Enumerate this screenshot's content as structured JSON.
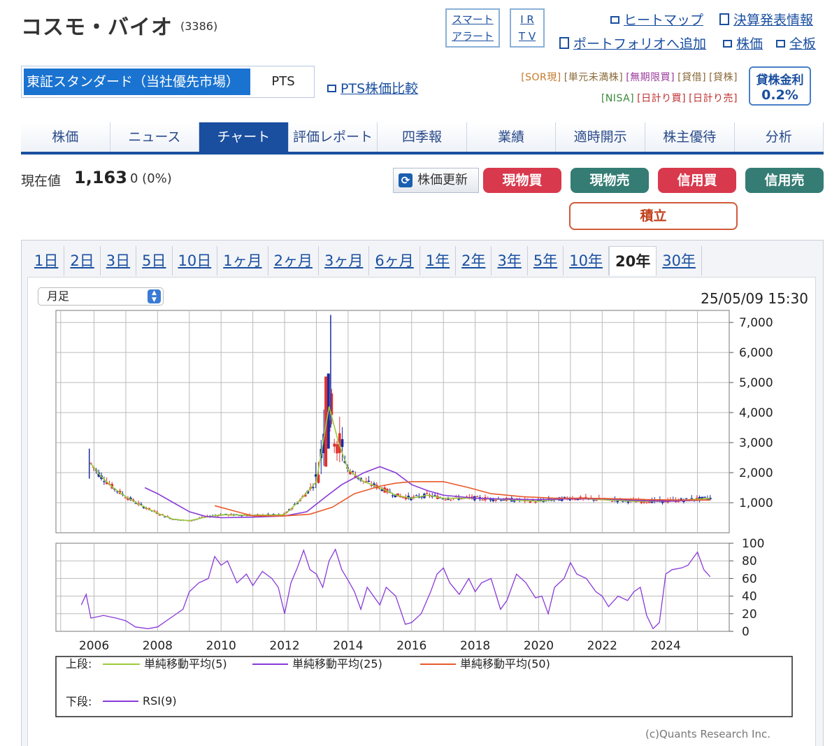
{
  "header": {
    "title": "コスモ・バイオ",
    "code": "(3386)",
    "smart_alert": [
      "スマート",
      "アラート"
    ],
    "irtv": [
      "I R",
      "T V"
    ],
    "links": {
      "heatmap": "ヒートマップ",
      "earnings": "決算発表情報",
      "portfolio": "ポートフォリオへ追加",
      "price": "株価",
      "board": "全板"
    }
  },
  "market": {
    "selected": "東証スタンダード（当社優先市場）",
    "pts": "PTS",
    "pts_compare": "PTS株価比較"
  },
  "tags": {
    "row1": [
      "[SOR現]",
      "[単元未満株]",
      "[無期限買]",
      "[貸借]",
      "[貸株]"
    ],
    "row2": [
      "[NISA]",
      "[日計り買]",
      "[日計り売]"
    ],
    "lending_label": "貸株金利",
    "lending_rate": "0.2%"
  },
  "tabs": [
    "株価",
    "ニュース",
    "チャート",
    "評価レポート",
    "四季報",
    "業績",
    "適時開示",
    "株主優待",
    "分析"
  ],
  "active_tab": "チャート",
  "price": {
    "label": "現在値",
    "value": "1,163",
    "change": "0 (0%)"
  },
  "buttons": {
    "refresh": "株価更新",
    "spot_buy": "現物買",
    "spot_sell": "現物売",
    "margin_buy": "信用買",
    "margin_sell": "信用売",
    "tsumitate": "積立"
  },
  "periods": [
    "1日",
    "2日",
    "3日",
    "5日",
    "10日",
    "1ヶ月",
    "2ヶ月",
    "3ヶ月",
    "6ヶ月",
    "1年",
    "2年",
    "3年",
    "5年",
    "10年",
    "20年",
    "30年"
  ],
  "active_period": "20年",
  "chart_ui": {
    "interval": "月足",
    "timestamp": "25/05/09 15:30",
    "legend_upper": "上段:",
    "legend_lower": "下段:",
    "copyright": "(c)Quants Research Inc."
  },
  "colors": {
    "up": "#e03030",
    "down": "#1a2aa0",
    "sma5": "#9ccc3a",
    "sma25": "#8a3ad8",
    "sma50": "#e85a2a",
    "rsi": "#8a3ad8"
  },
  "chart_data": [
    {
      "type": "line",
      "title": "",
      "x_ticks": [
        "2006",
        "2008",
        "2010",
        "2012",
        "2014",
        "2016",
        "2018",
        "2020",
        "2022",
        "2024"
      ],
      "y_ticks": [
        "1,000",
        "2,000",
        "3,000",
        "4,000",
        "5,000",
        "6,000",
        "7,000"
      ],
      "xlim": [
        2004.8,
        2026.0
      ],
      "ylim": [
        0,
        7400
      ],
      "grid": true,
      "series": [
        {
          "name": "単純移動平均(5)",
          "points": [
            [
              2005.9,
              2300
            ],
            [
              2006.2,
              1900
            ],
            [
              2006.6,
              1500
            ],
            [
              2007.0,
              1200
            ],
            [
              2007.5,
              900
            ],
            [
              2008.0,
              650
            ],
            [
              2008.5,
              450
            ],
            [
              2009.0,
              400
            ],
            [
              2009.5,
              520
            ],
            [
              2010.0,
              600
            ],
            [
              2011.0,
              580
            ],
            [
              2012.0,
              600
            ],
            [
              2012.5,
              1100
            ],
            [
              2013.0,
              1700
            ],
            [
              2013.4,
              4200
            ],
            [
              2013.7,
              3000
            ],
            [
              2014.0,
              2100
            ],
            [
              2014.5,
              1700
            ],
            [
              2015.0,
              1500
            ],
            [
              2015.5,
              1250
            ],
            [
              2016.0,
              1150
            ],
            [
              2016.5,
              1250
            ],
            [
              2017.0,
              1150
            ],
            [
              2018.0,
              1150
            ],
            [
              2019.0,
              1100
            ],
            [
              2020.0,
              1050
            ],
            [
              2021.0,
              1150
            ],
            [
              2022.0,
              1100
            ],
            [
              2023.0,
              1050
            ],
            [
              2024.0,
              1050
            ],
            [
              2025.0,
              1120
            ],
            [
              2025.4,
              1150
            ]
          ]
        },
        {
          "name": "単純移動平均(25)",
          "points": [
            [
              2007.6,
              1500
            ],
            [
              2008.0,
              1300
            ],
            [
              2008.5,
              1000
            ],
            [
              2009.0,
              700
            ],
            [
              2009.5,
              550
            ],
            [
              2010.0,
              500
            ],
            [
              2011.0,
              520
            ],
            [
              2012.0,
              560
            ],
            [
              2012.7,
              700
            ],
            [
              2013.3,
              1200
            ],
            [
              2013.8,
              1600
            ],
            [
              2014.5,
              2000
            ],
            [
              2015.0,
              2200
            ],
            [
              2015.5,
              2000
            ],
            [
              2016.0,
              1600
            ],
            [
              2016.5,
              1400
            ],
            [
              2017.0,
              1250
            ],
            [
              2018.0,
              1150
            ],
            [
              2019.0,
              1120
            ],
            [
              2020.0,
              1100
            ],
            [
              2021.0,
              1130
            ],
            [
              2022.0,
              1130
            ],
            [
              2023.0,
              1080
            ],
            [
              2024.0,
              1050
            ],
            [
              2025.0,
              1080
            ],
            [
              2025.4,
              1100
            ]
          ]
        },
        {
          "name": "単純移動平均(50)",
          "points": [
            [
              2009.8,
              900
            ],
            [
              2010.5,
              700
            ],
            [
              2011.0,
              560
            ],
            [
              2012.0,
              560
            ],
            [
              2012.8,
              620
            ],
            [
              2013.5,
              850
            ],
            [
              2014.2,
              1300
            ],
            [
              2015.0,
              1550
            ],
            [
              2015.5,
              1650
            ],
            [
              2016.0,
              1700
            ],
            [
              2017.0,
              1700
            ],
            [
              2017.8,
              1500
            ],
            [
              2018.5,
              1300
            ],
            [
              2019.5,
              1200
            ],
            [
              2020.5,
              1150
            ],
            [
              2021.5,
              1150
            ],
            [
              2022.5,
              1130
            ],
            [
              2023.5,
              1100
            ],
            [
              2024.5,
              1090
            ],
            [
              2025.4,
              1090
            ]
          ]
        }
      ]
    },
    {
      "type": "line",
      "title": "",
      "x_ticks": [
        "2006",
        "2008",
        "2010",
        "2012",
        "2014",
        "2016",
        "2018",
        "2020",
        "2022",
        "2024"
      ],
      "y_ticks": [
        "0",
        "20",
        "40",
        "60",
        "80",
        "100"
      ],
      "xlim": [
        2004.8,
        2026.0
      ],
      "ylim": [
        0,
        100
      ],
      "grid": true,
      "series": [
        {
          "name": "RSI(9)",
          "points": [
            [
              2005.6,
              30
            ],
            [
              2005.75,
              42
            ],
            [
              2005.9,
              15
            ],
            [
              2006.3,
              18
            ],
            [
              2006.7,
              15
            ],
            [
              2007.0,
              12
            ],
            [
              2007.3,
              5
            ],
            [
              2007.7,
              3
            ],
            [
              2008.0,
              5
            ],
            [
              2008.4,
              15
            ],
            [
              2008.8,
              25
            ],
            [
              2009.0,
              45
            ],
            [
              2009.3,
              55
            ],
            [
              2009.6,
              60
            ],
            [
              2009.8,
              85
            ],
            [
              2010.0,
              75
            ],
            [
              2010.2,
              80
            ],
            [
              2010.5,
              55
            ],
            [
              2010.8,
              65
            ],
            [
              2011.0,
              52
            ],
            [
              2011.3,
              68
            ],
            [
              2011.6,
              60
            ],
            [
              2011.8,
              50
            ],
            [
              2012.0,
              20
            ],
            [
              2012.2,
              55
            ],
            [
              2012.4,
              72
            ],
            [
              2012.6,
              92
            ],
            [
              2012.8,
              70
            ],
            [
              2013.0,
              65
            ],
            [
              2013.2,
              50
            ],
            [
              2013.4,
              80
            ],
            [
              2013.6,
              93
            ],
            [
              2013.8,
              70
            ],
            [
              2014.0,
              58
            ],
            [
              2014.2,
              45
            ],
            [
              2014.4,
              25
            ],
            [
              2014.6,
              50
            ],
            [
              2014.8,
              40
            ],
            [
              2015.0,
              30
            ],
            [
              2015.2,
              50
            ],
            [
              2015.5,
              40
            ],
            [
              2015.8,
              8
            ],
            [
              2016.0,
              10
            ],
            [
              2016.3,
              20
            ],
            [
              2016.6,
              45
            ],
            [
              2016.8,
              65
            ],
            [
              2017.0,
              72
            ],
            [
              2017.2,
              55
            ],
            [
              2017.5,
              42
            ],
            [
              2017.8,
              60
            ],
            [
              2018.0,
              45
            ],
            [
              2018.2,
              55
            ],
            [
              2018.5,
              60
            ],
            [
              2018.8,
              25
            ],
            [
              2019.0,
              35
            ],
            [
              2019.3,
              65
            ],
            [
              2019.6,
              55
            ],
            [
              2019.9,
              38
            ],
            [
              2020.1,
              40
            ],
            [
              2020.3,
              20
            ],
            [
              2020.5,
              50
            ],
            [
              2020.8,
              60
            ],
            [
              2021.0,
              78
            ],
            [
              2021.2,
              65
            ],
            [
              2021.5,
              60
            ],
            [
              2021.8,
              45
            ],
            [
              2022.0,
              40
            ],
            [
              2022.2,
              28
            ],
            [
              2022.5,
              40
            ],
            [
              2022.8,
              35
            ],
            [
              2023.0,
              45
            ],
            [
              2023.2,
              50
            ],
            [
              2023.4,
              18
            ],
            [
              2023.6,
              3
            ],
            [
              2023.8,
              10
            ],
            [
              2024.0,
              65
            ],
            [
              2024.2,
              70
            ],
            [
              2024.5,
              72
            ],
            [
              2024.7,
              75
            ],
            [
              2025.0,
              90
            ],
            [
              2025.2,
              70
            ],
            [
              2025.4,
              62
            ]
          ]
        }
      ]
    }
  ]
}
